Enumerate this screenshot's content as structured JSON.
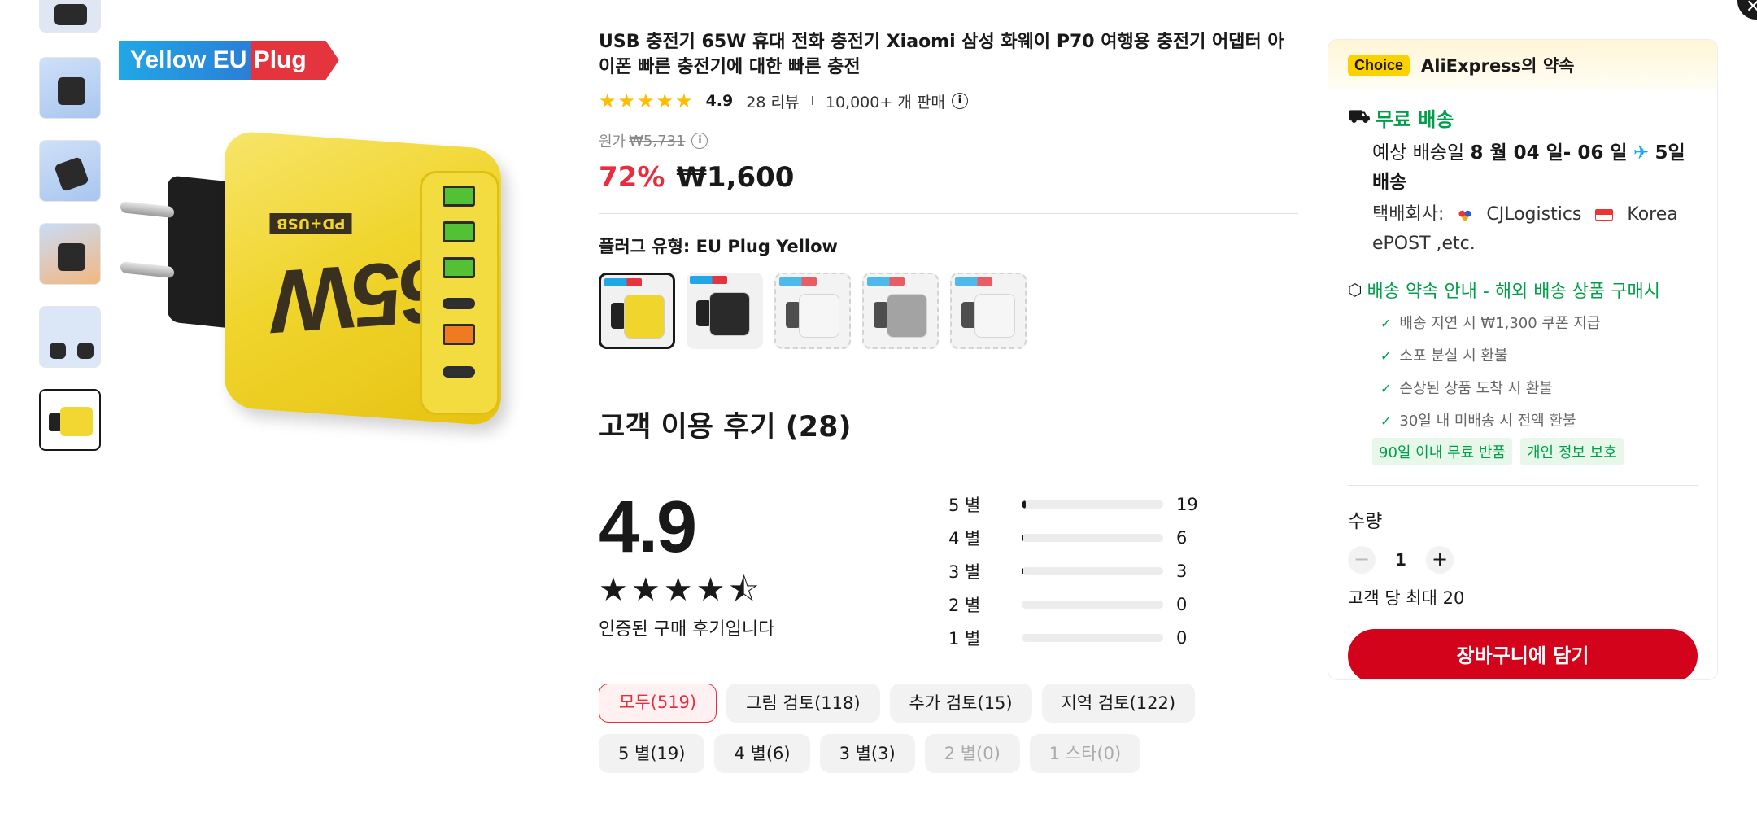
{
  "product": {
    "title": "USB 충전기 65W 휴대 전화 충전기 Xiaomi 삼성 화웨이 P70 여행용 충전기 어댑터 아이폰 빠른 충전기에 대한 빠른 충전",
    "image_tag": "Yellow EU Plug",
    "device_watt": "65W",
    "device_label": "PD+USB",
    "rating": "4.9",
    "review_count": "28 리뷰",
    "separator": "I",
    "sold": "10,000+ 개 판매",
    "original_label": "원가",
    "original_price": "₩5,731",
    "discount": "72%",
    "price": "₩1,600",
    "variant_label": "플러그 유형: EU Plug Yellow",
    "variants": [
      {
        "color": "#f0d52d",
        "selected": true,
        "available": true
      },
      {
        "color": "#2a2a2a",
        "selected": false,
        "available": true
      },
      {
        "color": "#f4f4f4",
        "selected": false,
        "available": false
      },
      {
        "color": "#8d8d8d",
        "selected": false,
        "available": false
      },
      {
        "color": "#f4f4f4",
        "selected": false,
        "available": false
      }
    ]
  },
  "reviews": {
    "title": "고객 이용 후기 (28)",
    "score": "4.9",
    "stars": 4.5,
    "verified_text": "인증된 구매 후기입니다",
    "distribution": [
      {
        "label": "5 별",
        "count": "19",
        "fraction": 0.03
      },
      {
        "label": "4 별",
        "count": "6",
        "fraction": 0.012
      },
      {
        "label": "3 별",
        "count": "3",
        "fraction": 0.012
      },
      {
        "label": "2 별",
        "count": "0",
        "fraction": 0
      },
      {
        "label": "1 별",
        "count": "0",
        "fraction": 0
      }
    ],
    "filters": [
      {
        "label": "모두(519)",
        "state": "active"
      },
      {
        "label": "그림 검토(118)",
        "state": "normal"
      },
      {
        "label": "추가 검토(15)",
        "state": "normal"
      },
      {
        "label": "지역 검토(122)",
        "state": "normal"
      },
      {
        "label": "5 별(19)",
        "state": "normal"
      },
      {
        "label": "4 별(6)",
        "state": "normal"
      },
      {
        "label": "3 별(3)",
        "state": "normal"
      },
      {
        "label": "2 별(0)",
        "state": "disabled"
      },
      {
        "label": "1 스타(0)",
        "state": "disabled"
      }
    ]
  },
  "panel": {
    "choice_badge": "Choice",
    "promise_title": "AliExpress의 약속",
    "free_shipping": "무료 배송",
    "delivery_prefix": "예상 배송일",
    "delivery_dates": "8 월 04 일- 06 일",
    "delivery_days": "5일",
    "delivery_suffix": "배송",
    "carrier_label": "택배회사:",
    "carrier_1": "CJLogistics",
    "carrier_2": "Korea",
    "carrier_more": "ePOST ,etc.",
    "promise_head": "배송 약속 안내 - 해외 배송 상품 구매시",
    "checks": [
      "배송 지연 시 ₩1,300 쿠폰 지급",
      "소포 분실 시 환불",
      "손상된 상품 도착 시 환불",
      "30일 내 미배송 시 전액 환불"
    ],
    "badges": [
      "90일 이내 무료 반품",
      "개인 정보 보호"
    ],
    "qty_label": "수량",
    "qty_minus": "−",
    "qty_value": "1",
    "qty_plus": "+",
    "qty_max": "고객 당 최대 20",
    "cart_button": "장바구니에 담기"
  },
  "colors": {
    "accent_red": "#e62e3f",
    "cart_red": "#d3031c",
    "green": "#00a04a",
    "star_yellow": "#fdbd00",
    "choice_yellow": "#fdd000"
  }
}
